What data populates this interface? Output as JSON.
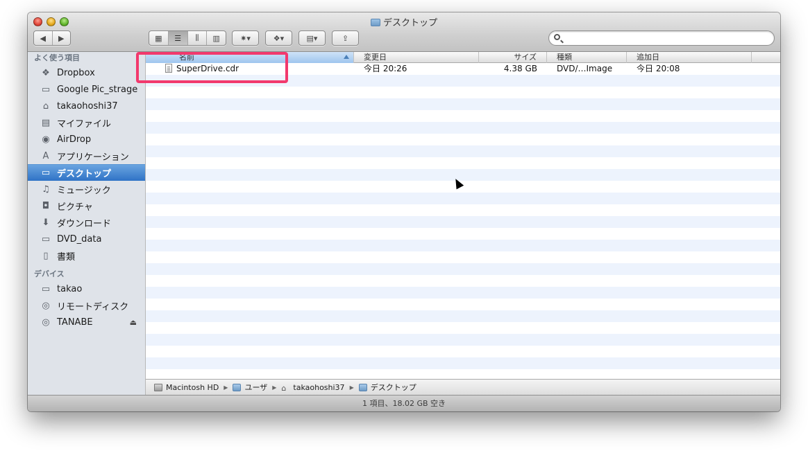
{
  "window": {
    "title": "デスクトップ"
  },
  "toolbar": {
    "nav_back": "◀",
    "nav_forward": "▶",
    "view_icon": "▦",
    "view_list": "☰",
    "view_columns": "⫼",
    "view_coverflow": "▥",
    "action_icon": "✷▾",
    "dropbox_icon": "❖▾",
    "arrange_icon": "▤▾",
    "share_icon": "⇪",
    "search_value": ""
  },
  "sidebar": {
    "favorites_header": "よく使う項目",
    "favorites": [
      {
        "label": "Dropbox",
        "icon": "dropbox-icon",
        "glyph": "❖"
      },
      {
        "label": "Google Pic_strage",
        "icon": "folder-icon",
        "glyph": "▭"
      },
      {
        "label": "takaohoshi37",
        "icon": "home-icon",
        "glyph": "⌂"
      },
      {
        "label": "マイファイル",
        "icon": "all-files-icon",
        "glyph": "▤"
      },
      {
        "label": "AirDrop",
        "icon": "airdrop-icon",
        "glyph": "◉"
      },
      {
        "label": "アプリケーション",
        "icon": "applications-icon",
        "glyph": "A"
      },
      {
        "label": "デスクトップ",
        "icon": "desktop-icon",
        "glyph": "▭",
        "selected": true
      },
      {
        "label": "ミュージック",
        "icon": "music-icon",
        "glyph": "♫"
      },
      {
        "label": "ピクチャ",
        "icon": "pictures-icon",
        "glyph": "◘"
      },
      {
        "label": "ダウンロード",
        "icon": "downloads-icon",
        "glyph": "⬇"
      },
      {
        "label": "DVD_data",
        "icon": "folder-icon",
        "glyph": "▭"
      },
      {
        "label": "書類",
        "icon": "documents-icon",
        "glyph": "▯"
      }
    ],
    "devices_header": "デバイス",
    "devices": [
      {
        "label": "takao",
        "icon": "laptop-icon",
        "glyph": "▭"
      },
      {
        "label": "リモートディスク",
        "icon": "remote-disc-icon",
        "glyph": "◎"
      },
      {
        "label": "TANABE",
        "icon": "disc-icon",
        "glyph": "◎",
        "eject": "⏏"
      }
    ]
  },
  "columns": {
    "name": "名前",
    "modified": "変更日",
    "size": "サイズ",
    "kind": "種類",
    "added": "追加日"
  },
  "files": [
    {
      "name": "SuperDrive.cdr",
      "modified": "今日 20:26",
      "size": "4.38 GB",
      "kind": "DVD/…Image",
      "added": "今日 20:08"
    }
  ],
  "pathbar": {
    "items": [
      "Macintosh HD",
      "ユーザ",
      "takaohoshi37",
      "デスクトップ"
    ]
  },
  "status": {
    "text": "1 項目、18.02 GB 空き"
  },
  "colors": {
    "highlight": "#f2396d",
    "selection": "#2f73c6",
    "stripe": "#edf3fd"
  }
}
